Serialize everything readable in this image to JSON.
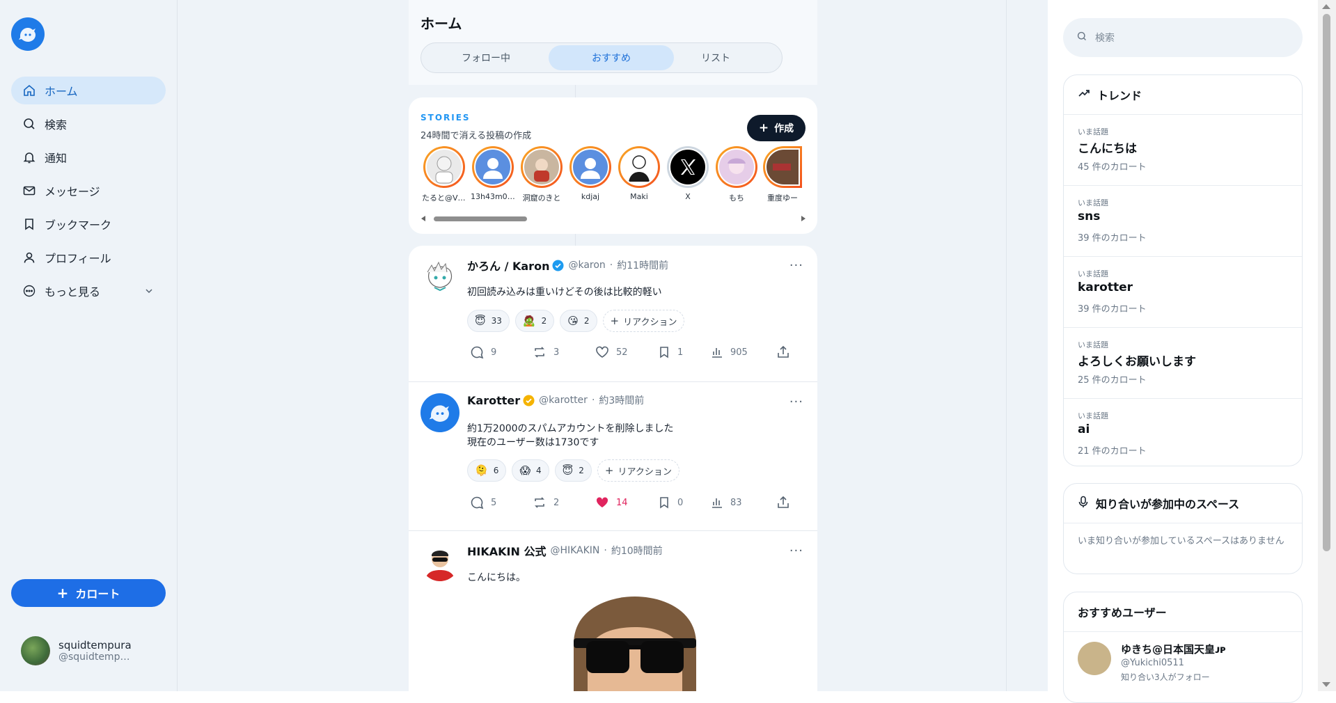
{
  "sidebar": {
    "items": [
      {
        "label": "ホーム",
        "icon": "home-icon",
        "active": true
      },
      {
        "label": "検索",
        "icon": "search-icon"
      },
      {
        "label": "通知",
        "icon": "bell-icon"
      },
      {
        "label": "メッセージ",
        "icon": "mail-icon"
      },
      {
        "label": "ブックマーク",
        "icon": "bookmark-icon"
      },
      {
        "label": "プロフィール",
        "icon": "user-icon"
      },
      {
        "label": "もっと見る",
        "icon": "more-circle-icon"
      }
    ],
    "post_button": "カロート",
    "user": {
      "name": "squidtempura",
      "handle": "@squidtemp…"
    }
  },
  "header": {
    "title": "ホーム",
    "tabs": [
      {
        "label": "フォロー中"
      },
      {
        "label": "おすすめ",
        "active": true
      },
      {
        "label": "リスト"
      }
    ]
  },
  "stories": {
    "label": "STORIES",
    "subtitle": "24時間で消える投稿の作成",
    "create_button": "作成",
    "items": [
      {
        "name": "たると@Vtu…"
      },
      {
        "name": "13h43m00s"
      },
      {
        "name": "洞窟のきと"
      },
      {
        "name": "kdjaj"
      },
      {
        "name": "Maki"
      },
      {
        "name": "X"
      },
      {
        "name": "もち"
      },
      {
        "name": "重度ゆー"
      }
    ]
  },
  "posts": [
    {
      "name": "かろん / Karon",
      "handle": "@karon",
      "time": "約11時間前",
      "body": "初回読み込みは重いけどその後は比較的軽い",
      "reactions": [
        {
          "emoji": "😇",
          "count": "33"
        },
        {
          "emoji": "🧟",
          "count": "2"
        },
        {
          "emoji": "😘",
          "count": "2"
        }
      ],
      "add_reaction": "リアクション",
      "replies": "9",
      "reposts": "3",
      "likes": "52",
      "bookmarks": "1",
      "views": "905"
    },
    {
      "name": "Karotter",
      "handle": "@karotter",
      "time": "約3時間前",
      "body_line1": "約1万2000のスパムアカウントを削除しました",
      "body_line2": "現在のユーザー数は1730です",
      "reactions": [
        {
          "emoji": "🫠",
          "count": "6"
        },
        {
          "emoji": "😱",
          "count": "4"
        },
        {
          "emoji": "😇",
          "count": "2"
        }
      ],
      "add_reaction": "リアクション",
      "replies": "5",
      "reposts": "2",
      "likes": "14",
      "bookmarks": "0",
      "views": "83"
    },
    {
      "name": "HIKAKIN 公式",
      "handle": "@HIKAKIN",
      "time": "約10時間前",
      "body": "こんにちは。"
    }
  ],
  "right": {
    "search_placeholder": "検索",
    "trends_title": "トレンド",
    "trends": [
      {
        "kicker": "いま話題",
        "word": "こんにちは",
        "count": "45 件のカロート"
      },
      {
        "kicker": "いま話題",
        "word": "sns",
        "count": "39 件のカロート"
      },
      {
        "kicker": "いま話題",
        "word": "karotter",
        "count": "39 件のカロート"
      },
      {
        "kicker": "いま話題",
        "word": "よろしくお願いします",
        "count": "25 件のカロート"
      },
      {
        "kicker": "いま話題",
        "word": "ai",
        "count": "21 件のカロート"
      }
    ],
    "spaces_title": "知り合いが参加中のスペース",
    "spaces_body": "いま知り合いが参加しているスペースはありません",
    "suggest_title": "おすすめユーザー",
    "suggest": {
      "name": "ゆきち@日本国天皇ᴊᴘ",
      "handle": "@Yukichi0511",
      "followers": "知り合い3人がフォロー"
    }
  },
  "colors": {
    "accent": "#1e6ee6",
    "like": "#e0245e",
    "story_ring": "#f4511e"
  }
}
